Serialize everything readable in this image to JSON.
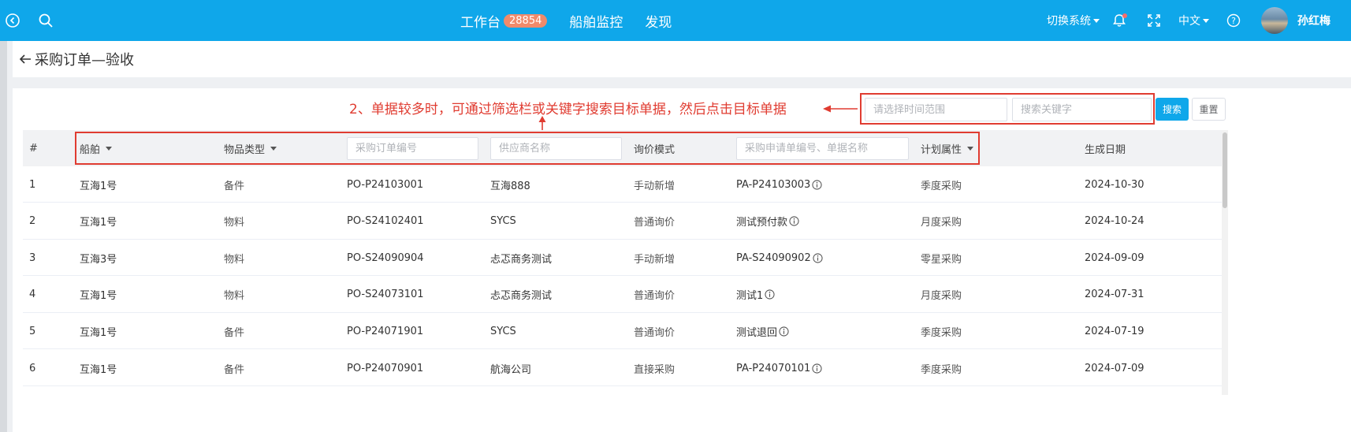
{
  "topbar": {
    "back_icon": "circle-arrow-left-icon",
    "search_icon": "search-icon",
    "nav": [
      {
        "label": "工作台",
        "badge": "28854"
      },
      {
        "label": "船舶监控"
      },
      {
        "label": "发现"
      }
    ],
    "switch_system": "切换系统",
    "language": "中文",
    "username": "孙红梅",
    "icons": [
      "bell-icon",
      "fullscreen-icon",
      "help-icon"
    ]
  },
  "breadcrumb": {
    "title": "采购订单—验收"
  },
  "annotation": {
    "text": "2、单据较多时，可通过筛选栏或关键字搜索目标单据，然后点击目标单据",
    "color": "#e03c31"
  },
  "filters": {
    "date_placeholder": "请选择时间范围",
    "keyword_placeholder": "搜索关键字",
    "search_label": "搜索",
    "reset_label": "重置"
  },
  "table": {
    "headers": {
      "index": "#",
      "vessel": "船舶",
      "item_type": "物品类型",
      "po_placeholder": "采购订单编号",
      "supplier_placeholder": "供应商名称",
      "inquiry_mode": "询价模式",
      "pa_placeholder": "采购申请单编号、单据名称",
      "plan_attr": "计划属性",
      "created_date": "生成日期"
    },
    "rows": [
      {
        "idx": "1",
        "vessel": "互海1号",
        "type": "备件",
        "po": "PO-P24103001",
        "supplier": "互海888",
        "mode": "手动新增",
        "pa": "PA-P24103003",
        "plan": "季度采购",
        "date": "2024-10-30"
      },
      {
        "idx": "2",
        "vessel": "互海1号",
        "type": "物料",
        "po": "PO-S24102401",
        "supplier": "SYCS",
        "mode": "普通询价",
        "pa": "测试预付款",
        "plan": "月度采购",
        "date": "2024-10-24"
      },
      {
        "idx": "3",
        "vessel": "互海3号",
        "type": "物料",
        "po": "PO-S24090904",
        "supplier": "忐忑商务测试",
        "mode": "手动新增",
        "pa": "PA-S24090902",
        "plan": "零星采购",
        "date": "2024-09-09"
      },
      {
        "idx": "4",
        "vessel": "互海1号",
        "type": "物料",
        "po": "PO-S24073101",
        "supplier": "忐忑商务测试",
        "mode": "普通询价",
        "pa": "测试1",
        "plan": "月度采购",
        "date": "2024-07-31"
      },
      {
        "idx": "5",
        "vessel": "互海1号",
        "type": "备件",
        "po": "PO-P24071901",
        "supplier": "SYCS",
        "mode": "普通询价",
        "pa": "测试退回",
        "plan": "季度采购",
        "date": "2024-07-19"
      },
      {
        "idx": "6",
        "vessel": "互海1号",
        "type": "备件",
        "po": "PO-P24070901",
        "supplier": "航海公司",
        "mode": "直接采购",
        "pa": "PA-P24070101",
        "plan": "季度采购",
        "date": "2024-07-09"
      }
    ]
  },
  "colors": {
    "brand": "#0fa7ea",
    "annotation": "#e03c31",
    "badge": "#f08a6b"
  }
}
